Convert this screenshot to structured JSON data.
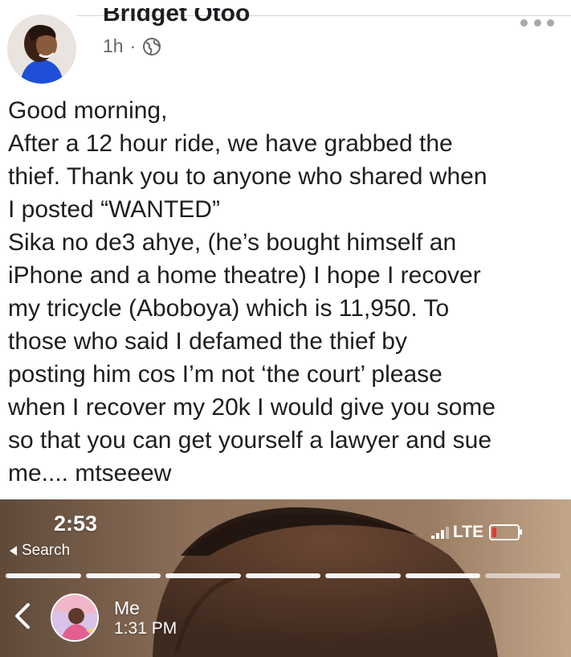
{
  "post": {
    "author": "Bridget Otoo",
    "time": "1h",
    "separator": "·",
    "lines": [
      "Good morning,",
      "After a 12 hour ride, we have grabbed the",
      "thief. Thank you to anyone who shared when",
      "I posted “WANTED”",
      "Sika no de3 ahye, (he’s bought himself an",
      "iPhone and a home theatre) I hope I recover",
      "my tricycle (Aboboya) which is 11,950. To",
      "those who said I defamed the thief by",
      "posting him cos I’m not ‘the court’ please",
      "when I recover my 20k I would give you some",
      "so that you can get yourself a lawyer and sue",
      "me.... mtseeew"
    ]
  },
  "icons": {
    "more": "more-horizontal-icon",
    "audience": "globe-icon"
  },
  "story_screenshot": {
    "clock": "2:53",
    "back_label": "Search",
    "network": "LTE",
    "battery_level": 0.15,
    "battery_color": "#e53935",
    "story_segments": 7,
    "viewer_name": "Me",
    "story_time": "1:31 PM"
  },
  "colors": {
    "text": "#1c1e21",
    "meta": "#65676b",
    "divider": "#d6d6d6"
  }
}
